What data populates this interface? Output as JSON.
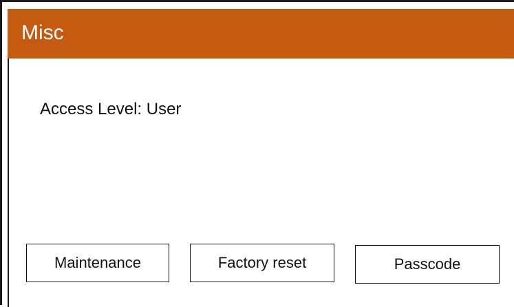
{
  "window": {
    "title": "Misc"
  },
  "content": {
    "access_level_text": "Access Level: User"
  },
  "buttons": {
    "maintenance_label": "Maintenance",
    "factory_reset_label": "Factory reset",
    "passcode_label": "Passcode"
  },
  "colors": {
    "header_background": "#c55a11",
    "header_text": "#ffffff",
    "border": "#1a1a1a",
    "background": "#ffffff"
  }
}
